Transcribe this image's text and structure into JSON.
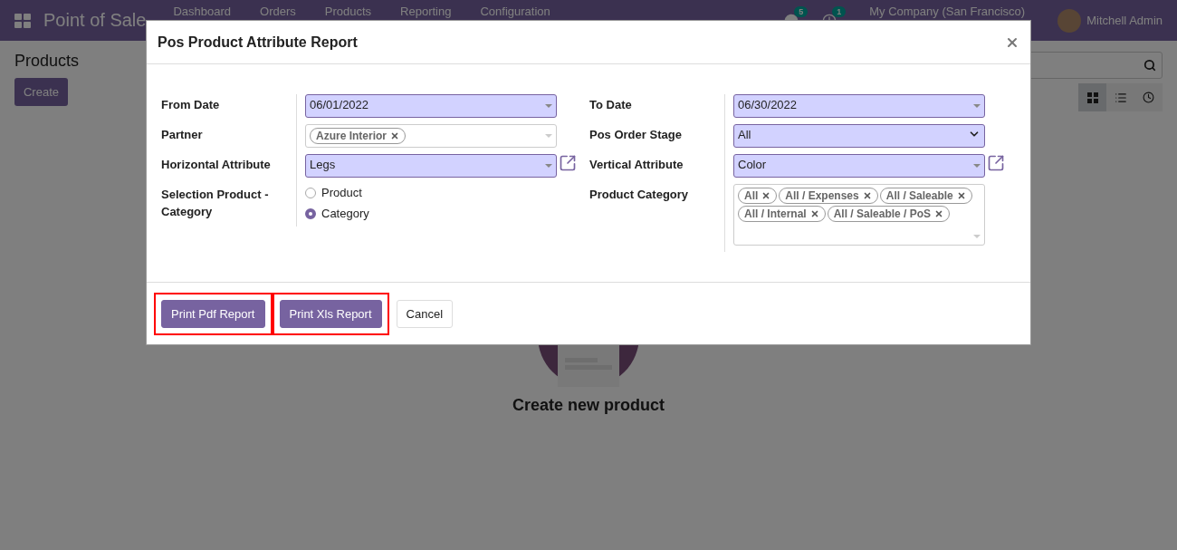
{
  "navbar": {
    "app_name": "Point of Sale",
    "menu": [
      "Dashboard",
      "Orders",
      "Products",
      "Reporting",
      "Configuration"
    ],
    "messages_badge": "5",
    "activities_badge": "1",
    "company": "My Company (San Francisco)",
    "user": "Mitchell Admin"
  },
  "control_panel": {
    "title": "Products",
    "create_button": "Create",
    "views": [
      {
        "kind": "kanban",
        "selected": true
      },
      {
        "kind": "list",
        "selected": false
      },
      {
        "kind": "activity",
        "selected": false
      }
    ]
  },
  "empty_state": {
    "title": "Create new product"
  },
  "dialog": {
    "title": "Pos Product Attribute Report",
    "left_fields": [
      {
        "label": "From Date",
        "kind": "date",
        "required": true,
        "value": "06/01/2022"
      },
      {
        "label": "Partner",
        "kind": "tags",
        "required": false,
        "tags": [
          "Azure Interior"
        ]
      },
      {
        "label": "Horizontal Attribute",
        "kind": "many2one",
        "required": true,
        "value": "Legs",
        "external_link": true
      },
      {
        "label": "Selection Product - Category",
        "kind": "radio",
        "options": [
          {
            "label": "Product",
            "selected": false
          },
          {
            "label": "Category",
            "selected": true
          }
        ]
      }
    ],
    "right_fields": [
      {
        "label": "To Date",
        "kind": "date",
        "required": true,
        "value": "06/30/2022"
      },
      {
        "label": "Pos Order Stage",
        "kind": "select",
        "required": true,
        "value": "All"
      },
      {
        "label": "Vertical Attribute",
        "kind": "many2one",
        "required": true,
        "value": "Color",
        "external_link": true
      },
      {
        "label": "Product Category",
        "kind": "tags",
        "required": false,
        "tall": true,
        "tags": [
          "All",
          "All / Expenses",
          "All / Saleable",
          "All / Internal",
          "All / Saleable / PoS"
        ]
      }
    ],
    "buttons": [
      {
        "label": "Print Pdf Report",
        "primary": true,
        "highlighted": true
      },
      {
        "label": "Print Xls Report",
        "primary": true,
        "highlighted": true
      },
      {
        "label": "Cancel",
        "primary": false,
        "highlighted": false
      }
    ]
  }
}
